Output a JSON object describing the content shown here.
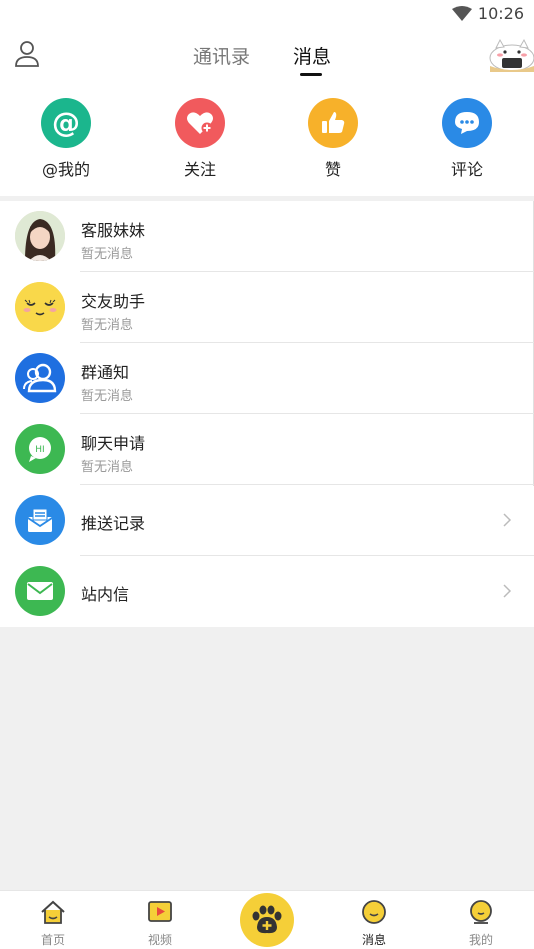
{
  "status_bar": {
    "time": "10:26"
  },
  "header": {
    "tabs": [
      {
        "label": "通讯录",
        "active": false
      },
      {
        "label": "消息",
        "active": true
      }
    ]
  },
  "quick_actions": [
    {
      "label": "@我的",
      "icon": "at-icon",
      "color": "#1bb68d"
    },
    {
      "label": "关注",
      "icon": "heart-plus-icon",
      "color": "#f15a5d"
    },
    {
      "label": "赞",
      "icon": "thumbs-up-icon",
      "color": "#f7b12a"
    },
    {
      "label": "评论",
      "icon": "chat-bubble-icon",
      "color": "#2a8ae6"
    }
  ],
  "conversations": [
    {
      "title": "客服妹妹",
      "subtitle": "暂无消息",
      "icon": "customer-service-avatar"
    },
    {
      "title": "交友助手",
      "subtitle": "暂无消息",
      "icon": "emoji-face-avatar"
    },
    {
      "title": "群通知",
      "subtitle": "暂无消息",
      "icon": "group-icon"
    },
    {
      "title": "聊天申请",
      "subtitle": "暂无消息",
      "icon": "hi-chat-icon"
    }
  ],
  "links": [
    {
      "title": "推送记录",
      "icon": "envelope-open-icon"
    },
    {
      "title": "站内信",
      "icon": "mail-icon"
    }
  ],
  "bottom_nav": [
    {
      "label": "首页",
      "icon": "home-icon",
      "active": false
    },
    {
      "label": "视频",
      "icon": "video-icon",
      "active": false
    },
    {
      "label": "消息",
      "icon": "message-face-icon",
      "active": true
    },
    {
      "label": "我的",
      "icon": "profile-face-icon",
      "active": false
    }
  ]
}
